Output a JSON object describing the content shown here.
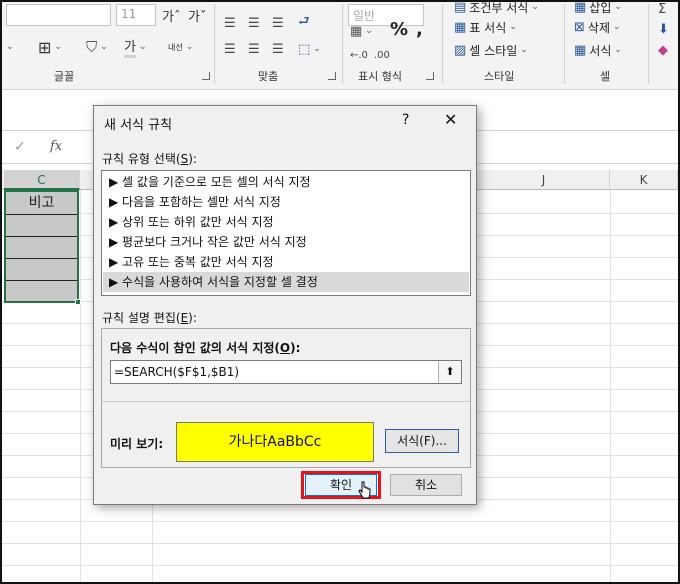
{
  "ribbon": {
    "font_size": "11",
    "font_name_placeholder": "",
    "groups": {
      "font": "글꼴",
      "align": "맞춤",
      "number": "표시 형식",
      "styles": "스타일",
      "cells": "셀"
    },
    "number_format_value": "일반",
    "styles_buttons": {
      "conditional": "조건부 서식",
      "as_table": "표 서식",
      "cell_styles": "셀 스타일"
    },
    "cells_buttons": {
      "insert": "삽입",
      "delete": "삭제",
      "format": "서식"
    },
    "vertical_text_label": "내선"
  },
  "formula_bar": {
    "fx_label": "fx"
  },
  "sheet": {
    "selected_column": "C",
    "columns_right": [
      "J",
      "K"
    ],
    "header_cell_text": "비고"
  },
  "dialog": {
    "title": "새 서식 규칙",
    "help": "?",
    "close": "✕",
    "select_rule_label": "규칙 유형 선택(",
    "select_rule_key": "S",
    "select_rule_end": "):",
    "rules": [
      "▶ 셀 값을 기준으로 모든 셀의 서식 지정",
      "▶ 다음을 포함하는 셀만 서식 지정",
      "▶ 상위 또는 하위 값만 서식 지정",
      "▶ 평균보다 크거나 작은 값만 서식 지정",
      "▶ 고유 또는 중복 값만 서식 지정",
      "▶ 수식을 사용하여 서식을 지정할 셀 결정"
    ],
    "edit_label": "규칙 설명 편집(",
    "edit_key": "E",
    "edit_end": "):",
    "formula_label": "다음 수식이 참인 값의 서식 지정(",
    "formula_key": "O",
    "formula_end": "):",
    "formula_value": "=SEARCH($F$1,$B1)",
    "preview_label": "미리 보기:",
    "preview_text": "가나다AaBbCc",
    "format_button": "서식(F)...",
    "ok_button": "확인",
    "cancel_button": "취소"
  },
  "colors": {
    "preview_fill": "#ffff00",
    "highlight": "#e8101a",
    "excel_green": "#217346"
  }
}
